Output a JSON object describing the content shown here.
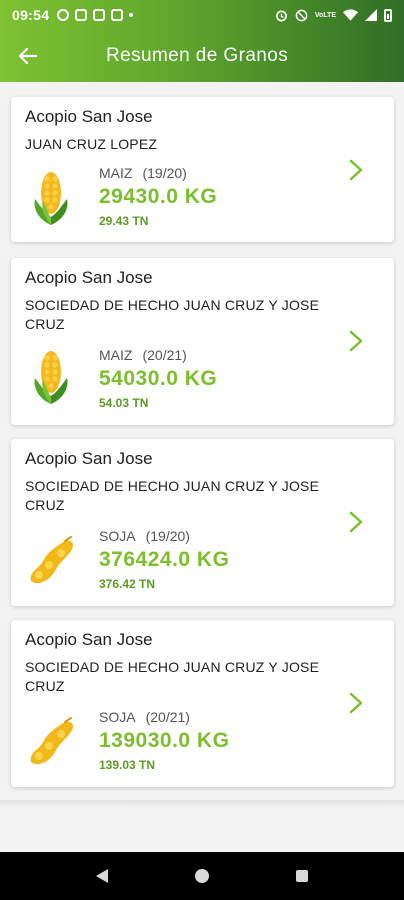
{
  "status_bar": {
    "time": "09:54",
    "left_icons": [
      "facebook-icon",
      "mail-icon",
      "laptop-icon",
      "instagram-icon",
      "dot-icon"
    ],
    "right_icons": [
      "alarm-icon",
      "no-sound-icon",
      "volte-icon",
      "wifi-icon",
      "signal-icon",
      "battery-icon"
    ],
    "volte_text": "VoLTE"
  },
  "app_bar": {
    "title": "Resumen de Granos",
    "back_icon": "arrow-back-icon"
  },
  "colors": {
    "accent": "#7cbf2e",
    "accent_dark": "#5d9a26",
    "gradient_start": "#7dc232",
    "gradient_end": "#2f6f25"
  },
  "cards": [
    {
      "acopio": "Acopio San Jose",
      "owner": "JUAN CRUZ LOPEZ",
      "grain": "MAIZ",
      "campaign": "(19/20)",
      "kg": "29430.0  KG",
      "tn": "29.43 TN",
      "icon": "corn-icon"
    },
    {
      "acopio": "Acopio San Jose",
      "owner": "SOCIEDAD DE HECHO JUAN CRUZ Y JOSE CRUZ",
      "grain": "MAIZ",
      "campaign": "(20/21)",
      "kg": "54030.0  KG",
      "tn": "54.03 TN",
      "icon": "corn-icon"
    },
    {
      "acopio": "Acopio San Jose",
      "owner": "SOCIEDAD DE HECHO JUAN CRUZ Y JOSE CRUZ",
      "grain": "SOJA",
      "campaign": "(19/20)",
      "kg": "376424.0  KG",
      "tn": "376.42 TN",
      "icon": "soybean-icon"
    },
    {
      "acopio": "Acopio San Jose",
      "owner": "SOCIEDAD DE HECHO JUAN CRUZ Y JOSE CRUZ",
      "grain": "SOJA",
      "campaign": "(20/21)",
      "kg": "139030.0  KG",
      "tn": "139.03 TN",
      "icon": "soybean-icon"
    }
  ],
  "nav_bar": {
    "items": [
      "back-nav-icon",
      "home-nav-icon",
      "recents-nav-icon"
    ]
  }
}
